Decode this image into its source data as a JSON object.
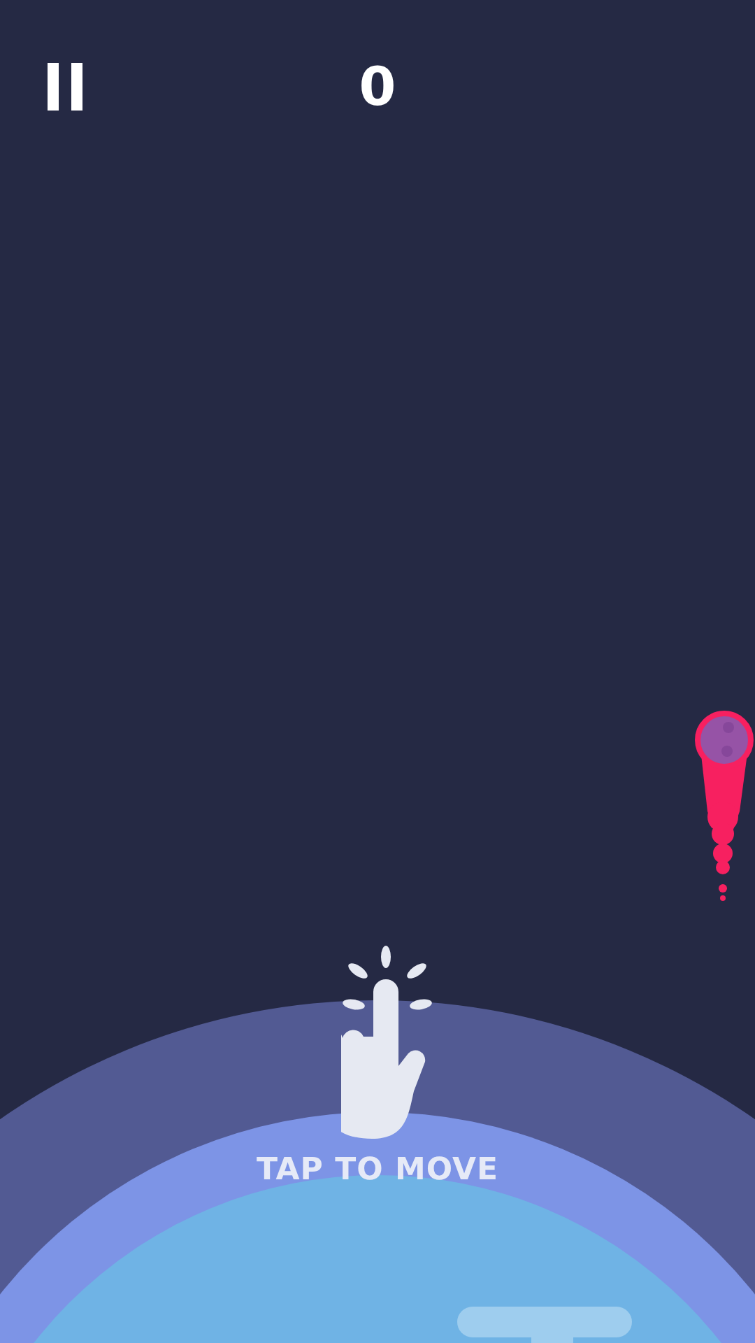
{
  "score": "0",
  "hint": "TAP TO MOVE"
}
